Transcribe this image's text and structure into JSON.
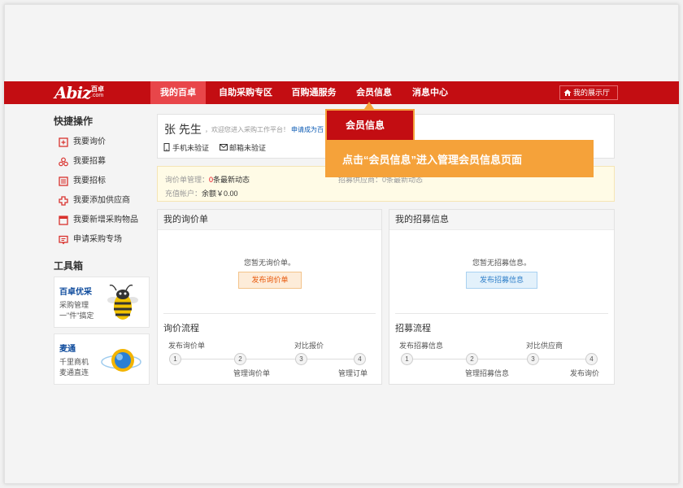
{
  "colors": {
    "brand": "#c30d12",
    "nav_active": "#e8464a",
    "callout": "#f5a23a"
  },
  "logo": {
    "mark": "Abiz",
    "cn": "百卓",
    "com": ".com"
  },
  "nav": {
    "items": [
      {
        "label": "我的百卓",
        "active": true
      },
      {
        "label": "自助采购专区"
      },
      {
        "label": "百购通服务"
      },
      {
        "label": "会员信息"
      },
      {
        "label": "消息中心"
      }
    ],
    "showroom_label": "我的展示厅",
    "showroom_icon": "home-icon"
  },
  "sidebar": {
    "quick_title": "快捷操作",
    "items": [
      {
        "label": "我要询价",
        "icon": "inquiry-icon"
      },
      {
        "label": "我要招募",
        "icon": "recruit-icon"
      },
      {
        "label": "我要招标",
        "icon": "tender-icon"
      },
      {
        "label": "我要添加供应商",
        "icon": "add-supplier-icon"
      },
      {
        "label": "我要新增采购物品",
        "icon": "add-item-icon"
      },
      {
        "label": "申请采购专场",
        "icon": "apply-icon"
      }
    ],
    "tools_title": "工具箱",
    "tools": [
      {
        "name": "百卓优采",
        "desc1": "采购管理",
        "desc2": "一\"件\"搞定",
        "icon": "bee-icon"
      },
      {
        "name": "麦通",
        "desc1": "千里商机",
        "desc2": "麦通直连",
        "icon": "globe-icon"
      }
    ]
  },
  "user": {
    "name": "张 先生",
    "welcome": "，欢迎您进入采购工作平台！",
    "apply_link": "申请成为百",
    "phone_status": "手机未验证",
    "email_status": "邮箱未验证"
  },
  "stats": {
    "inquiry_label": "询价单管理：",
    "inquiry_count": "0",
    "inquiry_suffix": "条最新动态",
    "recruit_label": "招募供应商：",
    "recruit_count": "0",
    "recruit_suffix": "条最新动态",
    "account_label": "充值帐户：",
    "balance": "余额￥0.00"
  },
  "inquiry_box": {
    "title": "我的询价单",
    "empty": "您暂无询价单。",
    "button": "发布询价单",
    "flow_title": "询价流程",
    "steps": [
      "1",
      "2",
      "3",
      "4"
    ],
    "labels_top": [
      "发布询价单",
      "对比报价"
    ],
    "labels_bottom": [
      "管理询价单",
      "管理订单"
    ]
  },
  "recruit_box": {
    "title": "我的招募信息",
    "empty": "您暂无招募信息。",
    "button": "发布招募信息",
    "flow_title": "招募流程",
    "steps": [
      "1",
      "2",
      "3",
      "4"
    ],
    "labels_top": [
      "发布招募信息",
      "对比供应商"
    ],
    "labels_bottom": [
      "管理招募信息",
      "发布询价"
    ]
  },
  "callout": {
    "tab_label": "会员信息",
    "banner": "点击“会员信息”进入管理会员信息页面"
  }
}
